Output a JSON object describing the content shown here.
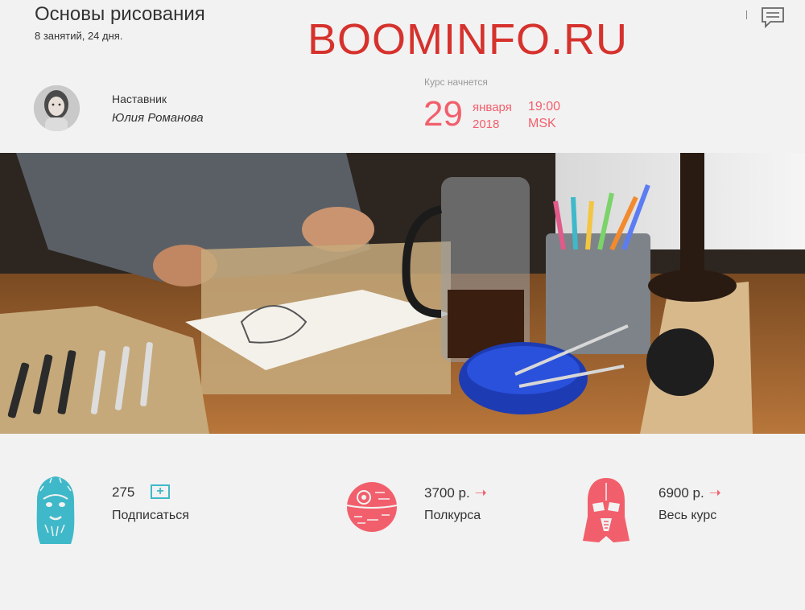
{
  "course": {
    "title": "Основы рисования",
    "meta": "8  занятий, 24 дня."
  },
  "watermark": "BOOMINFO.RU",
  "mentor": {
    "label": "Наставник",
    "name": "Юлия Романова"
  },
  "start": {
    "label": "Курс начнется",
    "day": "29",
    "month": "января",
    "year": "2018",
    "time": "19:00",
    "timezone": "MSK"
  },
  "offers": [
    {
      "value": "275",
      "label": "Подписаться",
      "icon": "wookiee-icon",
      "color": "#3fb9c9"
    },
    {
      "value": "3700 р.",
      "label": "Полкурса",
      "icon": "death-star-icon",
      "color": "#f25f6c"
    },
    {
      "value": "6900 р.",
      "label": "Весь курс",
      "icon": "darth-vader-icon",
      "color": "#f25f6c"
    }
  ],
  "colors": {
    "accent": "#f25f6c",
    "subscribe": "#3fb9c9",
    "watermark": "#d6322d"
  },
  "icons": {
    "chat": "chat-icon",
    "plus": "plus-icon",
    "arrow": "arrow-right-icon"
  }
}
